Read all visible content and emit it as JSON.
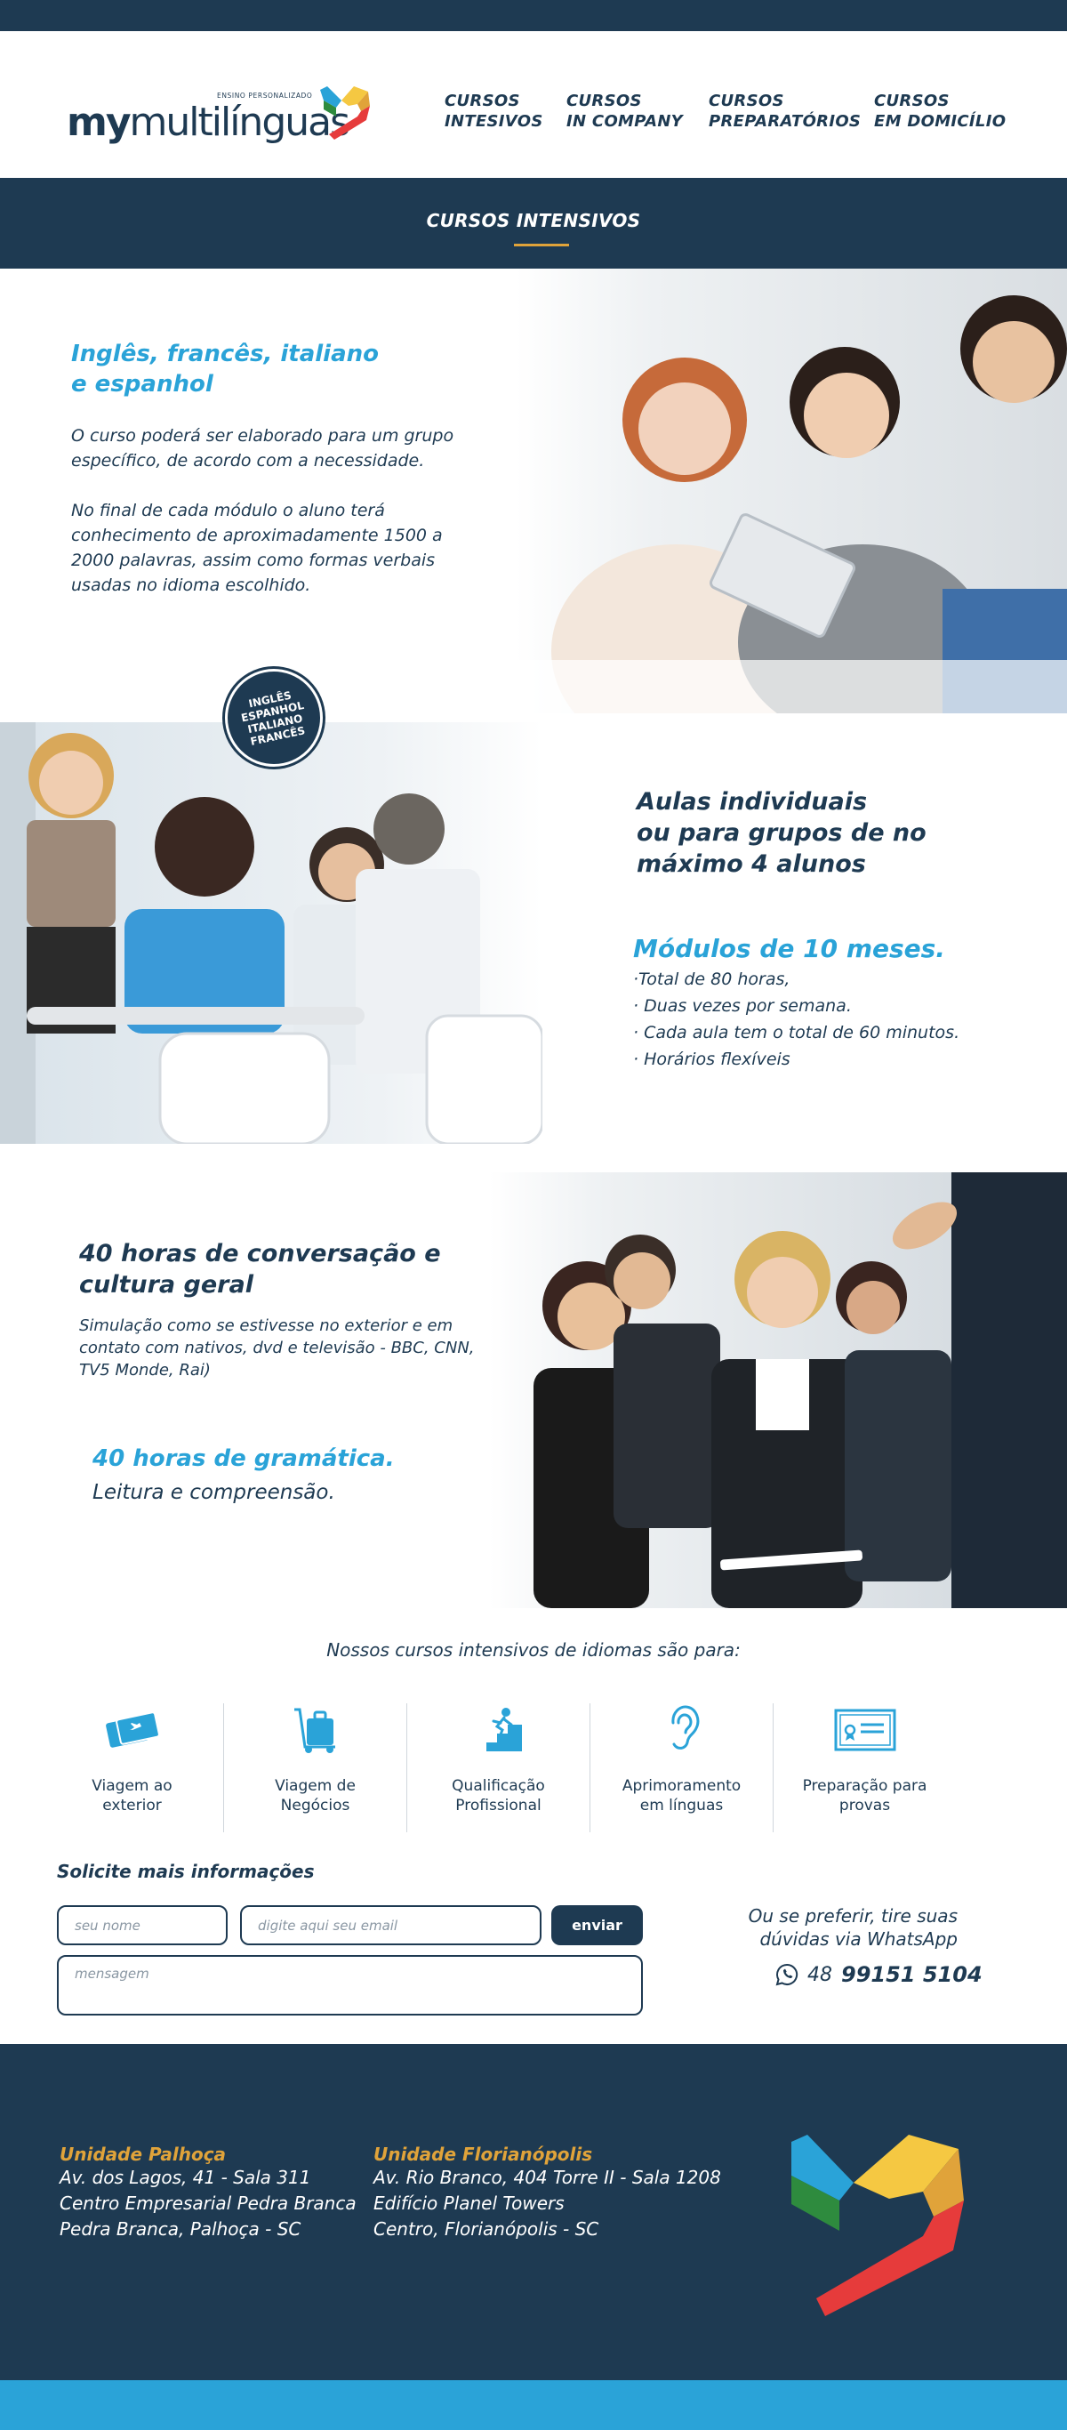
{
  "header": {
    "logo_bold": "my",
    "logo_rest": "multilínguas",
    "logo_tagline": "ENSINO PERSONALIZADO",
    "nav": [
      {
        "line1": "CURSOS",
        "line2": "INTESIVOS"
      },
      {
        "line1": "CURSOS",
        "line2": "IN COMPANY"
      },
      {
        "line1": "CURSOS",
        "line2": "PREPARATÓRIOS"
      },
      {
        "line1": "CURSOS",
        "line2": "EM DOMICÍLIO"
      }
    ]
  },
  "band": {
    "title": "CURSOS INTENSIVOS"
  },
  "section1": {
    "title_line1": "Inglês, francês, italiano",
    "title_line2": "e espanhol",
    "p1": "O curso poderá ser elaborado para um grupo específico, de acordo com a necessidade.",
    "p2": "No final de cada módulo o aluno terá conhecimento de aproximadamente 1500 a 2000 palavras, assim como formas verbais usadas no idioma escolhido."
  },
  "badge": {
    "lines": [
      "INGLÊS",
      "ESPANHOL",
      "ITALIANO",
      "FRANCÊS"
    ]
  },
  "section2": {
    "title_line1": "Aulas individuais",
    "title_line2": "ou para grupos de no",
    "title_line3": "máximo 4 alunos",
    "modules_title": "Módulos de 10 meses.",
    "items": [
      "·Total de 80 horas,",
      "· Duas vezes por semana.",
      "· Cada aula tem o total de 60 minutos.",
      "· Horários flexíveis"
    ]
  },
  "section3": {
    "title_line1": "40 horas de conversação e",
    "title_line2": "cultura geral",
    "text": "Simulação como se estivesse no exterior e em contato com nativos, dvd e televisão - BBC, CNN, TV5 Monde, Rai)",
    "grammar_title": "40 horas de gramática.",
    "grammar_text": "Leitura e compreensão."
  },
  "uses": {
    "title": "Nossos cursos intensivos de idiomas são para:",
    "items": [
      {
        "line1": "Viagem ao",
        "line2": "exterior",
        "icon": "tickets-icon"
      },
      {
        "line1": "Viagem de",
        "line2": "Negócios",
        "icon": "luggage-icon"
      },
      {
        "line1": "Qualificação",
        "line2": "Profissional",
        "icon": "stairs-climb-icon"
      },
      {
        "line1": "Aprimoramento",
        "line2": "em línguas",
        "icon": "ear-icon"
      },
      {
        "line1": "Preparação para",
        "line2": "provas",
        "icon": "certificate-icon"
      }
    ]
  },
  "form": {
    "title": "Solicite mais informações",
    "name_placeholder": "seu nome",
    "email_placeholder": "digite aqui seu email",
    "message_placeholder": "mensagem",
    "submit_label": "enviar"
  },
  "whatsapp": {
    "line1": "Ou se preferir, tire suas",
    "line2": "dúvidas via WhatsApp",
    "area": "48",
    "number": "99151 5104",
    "icon": "whatsapp-icon"
  },
  "footer": {
    "units": [
      {
        "name": "Unidade Palhoça",
        "l1": "Av. dos Lagos, 41 - Sala 311",
        "l2": "Centro Empresarial Pedra Branca",
        "l3": "Pedra Branca, Palhoça - SC"
      },
      {
        "name": "Unidade Florianópolis",
        "l1": "Av. Rio Branco, 404 Torre II - Sala 1208",
        "l2": "Edifício Planel Towers",
        "l3": "Centro, Florianópolis - SC"
      }
    ]
  },
  "colors": {
    "navy": "#1e3a52",
    "blue": "#2aa3d8",
    "orange": "#e0a33a",
    "red": "#e63b3b",
    "yellow": "#f5c842",
    "green": "#2e8b3e"
  }
}
